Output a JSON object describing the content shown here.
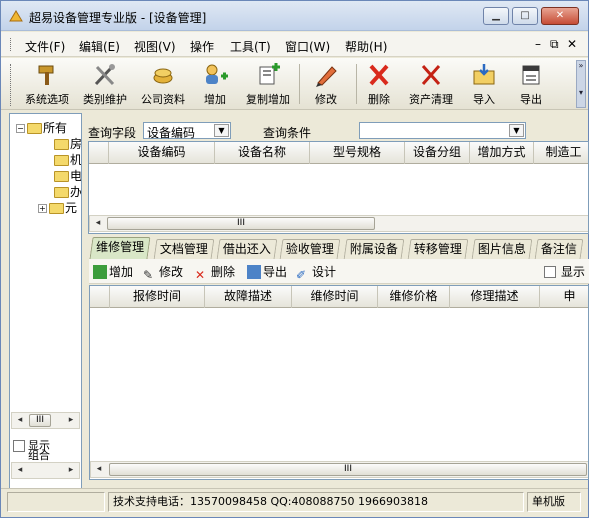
{
  "window": {
    "title": "超易设备管理专业版 - [设备管理]"
  },
  "menu": [
    "文件(F)",
    "编辑(E)",
    "视图(V)",
    "操作",
    "工具(T)",
    "窗口(W)",
    "帮助(H)"
  ],
  "toolbar": [
    "系统选项",
    "类别维护",
    "公司资料",
    "增加",
    "复制增加",
    "修改",
    "删除",
    "资产清理",
    "导入",
    "导出"
  ],
  "tree": {
    "root": "所有",
    "children": [
      "房",
      "机",
      "电",
      "办",
      "元"
    ]
  },
  "query": {
    "field_label": "查询字段",
    "field_value": "设备编码",
    "cond_label": "查询条件",
    "cond_value": ""
  },
  "main_grid": {
    "columns": [
      "设备编码",
      "设备名称",
      "型号规格",
      "设备分组",
      "增加方式",
      "制造工"
    ]
  },
  "tabs": [
    "维修管理",
    "文档管理",
    "借出还入",
    "验收管理",
    "附属设备",
    "转移管理",
    "图片信息",
    "备注信"
  ],
  "sub_toolbar": {
    "add": "增加",
    "edit": "修改",
    "delete": "删除",
    "export": "导出",
    "design": "设计",
    "show_label": "显示"
  },
  "repair_grid": {
    "columns": [
      "报修时间",
      "故障描述",
      "维修时间",
      "维修价格",
      "修理描述",
      "申"
    ]
  },
  "left_checks": {
    "show_label": "显示",
    "group_label": "组合"
  },
  "scroll_mark": "III",
  "status": {
    "support": "技术支持电话：13570098458 QQ:408088750 1966903818",
    "mode": "单机版"
  }
}
